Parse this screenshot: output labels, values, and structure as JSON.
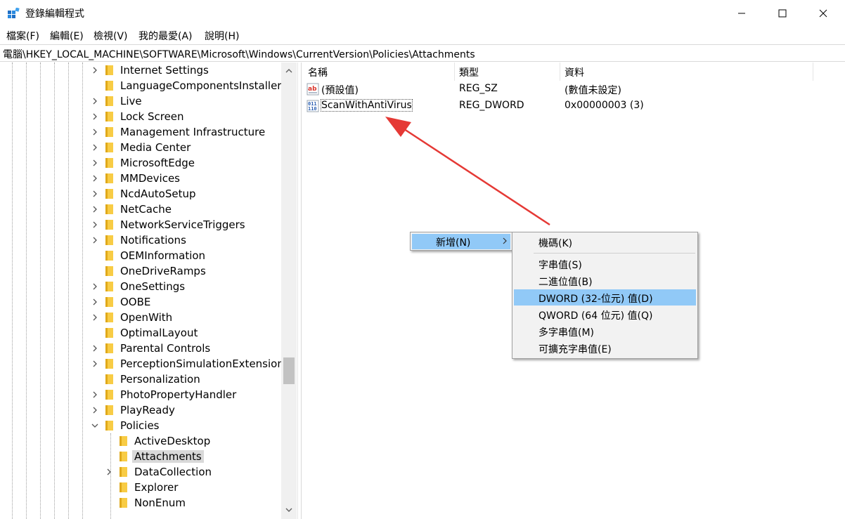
{
  "window": {
    "title": "登錄編輯程式",
    "minimize_icon": "minimize-icon",
    "maximize_icon": "maximize-icon",
    "close_icon": "close-icon"
  },
  "menubar": [
    {
      "label": "檔案(F)"
    },
    {
      "label": "編輯(E)"
    },
    {
      "label": "檢視(V)"
    },
    {
      "label": "我的最愛(A)"
    },
    {
      "label": "說明(H)"
    }
  ],
  "address": "電腦\\HKEY_LOCAL_MACHINE\\SOFTWARE\\Microsoft\\Windows\\CurrentVersion\\Policies\\Attachments",
  "tree": {
    "items": [
      {
        "label": "Internet Settings",
        "expandable": true
      },
      {
        "label": "LanguageComponentsInstaller",
        "expandable": false
      },
      {
        "label": "Live",
        "expandable": true
      },
      {
        "label": "Lock Screen",
        "expandable": true
      },
      {
        "label": "Management Infrastructure",
        "expandable": true
      },
      {
        "label": "Media Center",
        "expandable": true
      },
      {
        "label": "MicrosoftEdge",
        "expandable": true
      },
      {
        "label": "MMDevices",
        "expandable": true
      },
      {
        "label": "NcdAutoSetup",
        "expandable": true
      },
      {
        "label": "NetCache",
        "expandable": true
      },
      {
        "label": "NetworkServiceTriggers",
        "expandable": true
      },
      {
        "label": "Notifications",
        "expandable": true
      },
      {
        "label": "OEMInformation",
        "expandable": false
      },
      {
        "label": "OneDriveRamps",
        "expandable": false
      },
      {
        "label": "OneSettings",
        "expandable": true
      },
      {
        "label": "OOBE",
        "expandable": true
      },
      {
        "label": "OpenWith",
        "expandable": true
      },
      {
        "label": "OptimalLayout",
        "expandable": false
      },
      {
        "label": "Parental Controls",
        "expandable": true
      },
      {
        "label": "PerceptionSimulationExtensions",
        "expandable": true
      },
      {
        "label": "Personalization",
        "expandable": false
      },
      {
        "label": "PhotoPropertyHandler",
        "expandable": true
      },
      {
        "label": "PlayReady",
        "expandable": true
      },
      {
        "label": "Policies",
        "expandable": true,
        "expanded": true
      },
      {
        "label": "ActiveDesktop",
        "expandable": false,
        "child": true
      },
      {
        "label": "Attachments",
        "expandable": false,
        "child": true,
        "selected": true
      },
      {
        "label": "DataCollection",
        "expandable": true,
        "child": true
      },
      {
        "label": "Explorer",
        "expandable": false,
        "child": true
      },
      {
        "label": "NonEnum",
        "expandable": false,
        "child": true
      }
    ]
  },
  "list": {
    "columns": {
      "name": "名稱",
      "type": "類型",
      "data": "資料"
    },
    "rows": [
      {
        "name": "(預設值)",
        "type": "REG_SZ",
        "data": "(數值未設定)",
        "icon": "reg-sz-icon"
      },
      {
        "name": "ScanWithAntiVirus",
        "type": "REG_DWORD",
        "data": "0x00000003 (3)",
        "icon": "reg-dword-icon"
      }
    ]
  },
  "context_menu": {
    "new_label": "新增(N)",
    "submenu": {
      "key": "機碼(K)",
      "string": "字串值(S)",
      "binary": "二進位值(B)",
      "dword": "DWORD (32-位元) 值(D)",
      "qword": "QWORD (64 位元) 值(Q)",
      "multi": "多字串值(M)",
      "expand": "可擴充字串值(E)"
    }
  },
  "colors": {
    "selection": "#91c9f7",
    "tree_selected": "#d9d9d9",
    "annotation_arrow": "#e53935",
    "folder": "#f8cc45"
  }
}
